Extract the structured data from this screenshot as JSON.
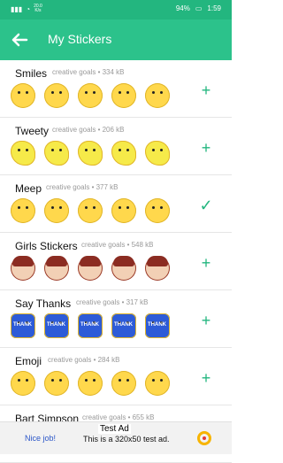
{
  "status": {
    "time": "1:59",
    "battery": "94%",
    "net_top": "20.0",
    "net_bottom": "K/s"
  },
  "appbar": {
    "title": "My Stickers"
  },
  "packs": [
    {
      "name": "Smiles",
      "meta": "creative goals • 334 kB",
      "action": "plus",
      "kind": "face"
    },
    {
      "name": "Tweety",
      "meta": "creative goals • 206 kB",
      "action": "plus",
      "kind": "bird"
    },
    {
      "name": "Meep",
      "meta": "creative goals • 377 kB",
      "action": "check",
      "kind": "face"
    },
    {
      "name": "Girls Stickers",
      "meta": "creative goals • 548 kB",
      "action": "plus",
      "kind": "girl"
    },
    {
      "name": "Say Thanks",
      "meta": "creative goals • 317 kB",
      "action": "plus",
      "kind": "thanks"
    },
    {
      "name": "Emoji",
      "meta": "creative goals • 284 kB",
      "action": "plus",
      "kind": "face"
    },
    {
      "name": "Bart Simpson",
      "meta": "creative goals • 655 kB",
      "action": "none",
      "kind": "face"
    }
  ],
  "ad": {
    "nice": "Nice job!",
    "tag": "Test Ad",
    "text": "This is a 320x50 test ad."
  }
}
